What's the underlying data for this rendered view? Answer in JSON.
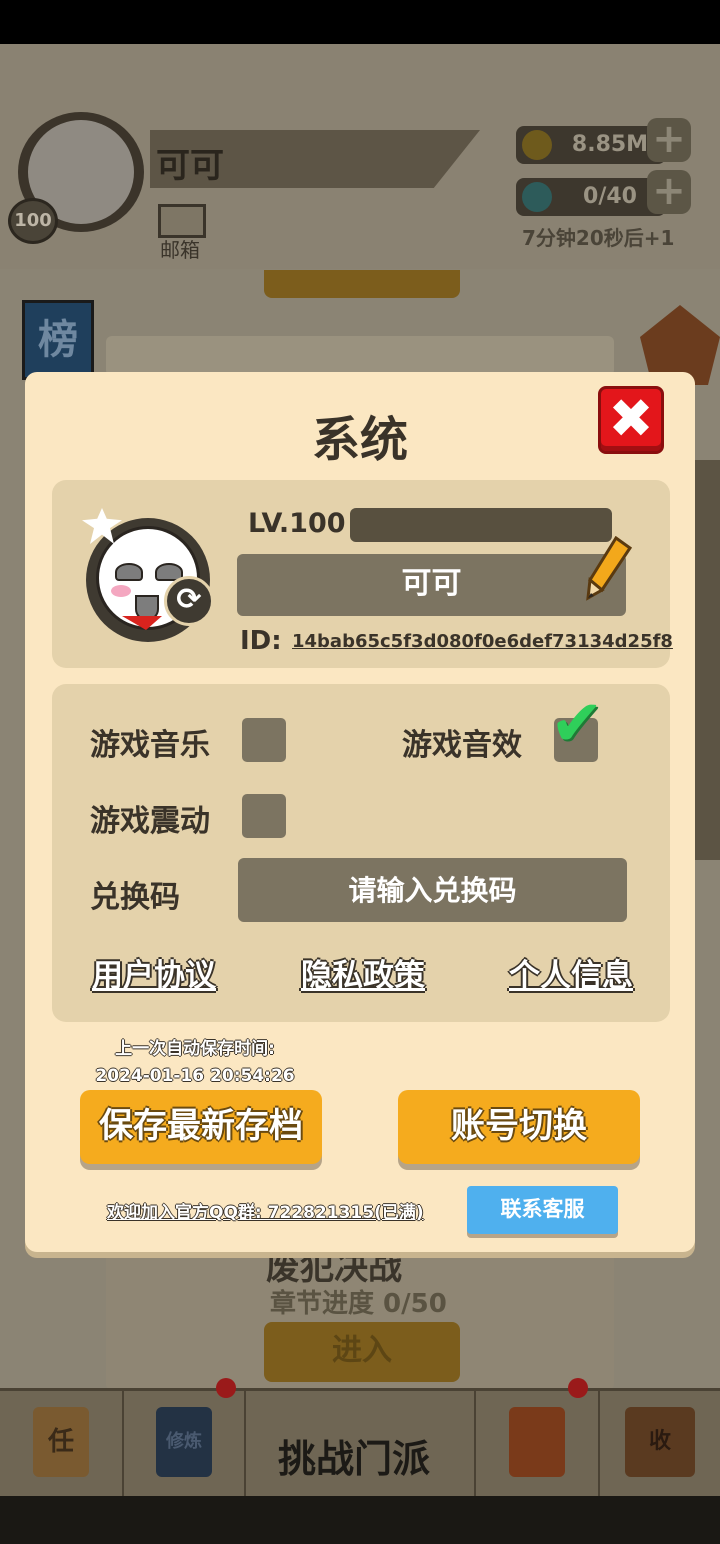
{
  "background": {
    "player_name": "可可",
    "player_level_badge": "100",
    "mail_label": "邮箱",
    "coins": "8.85M",
    "gems": "0/40",
    "regen_timer": "7分钟20秒后+1",
    "leaderboard_tab": "榜",
    "chapter_title": "废犯决战",
    "chapter_progress": "章节进度 0/50",
    "enter_button": "进入",
    "nav": {
      "task_icon_char": "任",
      "training_icon_char": "修炼",
      "center_label": "挑战门派",
      "collect_icon_char": "收"
    }
  },
  "dialog": {
    "title": "系统",
    "close_icon": "close-x-icon",
    "profile": {
      "level": "LV.100",
      "nickname": "可可",
      "id_label": "ID:",
      "id_value": "14bab65c5f3d080f0e6def73134d25f8"
    },
    "settings": {
      "music_label": "游戏音乐",
      "music_on": false,
      "sfx_label": "游戏音效",
      "sfx_on": true,
      "vibration_label": "游戏震动",
      "vibration_on": false,
      "redeem_label": "兑换码",
      "redeem_placeholder": "请输入兑换码",
      "links": {
        "user_agreement": "用户协议",
        "privacy_policy": "隐私政策",
        "personal_info": "个人信息"
      }
    },
    "autosave_label": "上一次自动保存时间:",
    "autosave_time": "2024-01-16 20:54:26",
    "save_button": "保存最新存档",
    "switch_account_button": "账号切换",
    "qq_group_text": "欢迎加入官方QQ群: 722821315(已满)",
    "contact_service_button": "联系客服"
  },
  "colors": {
    "accent_orange": "#f5ab1e",
    "close_red": "#e3161b",
    "check_green": "#2fcf5a",
    "service_blue": "#4fb0ee",
    "dialog_bg": "#fbe7c2",
    "card_bg": "#e4d2ab"
  }
}
